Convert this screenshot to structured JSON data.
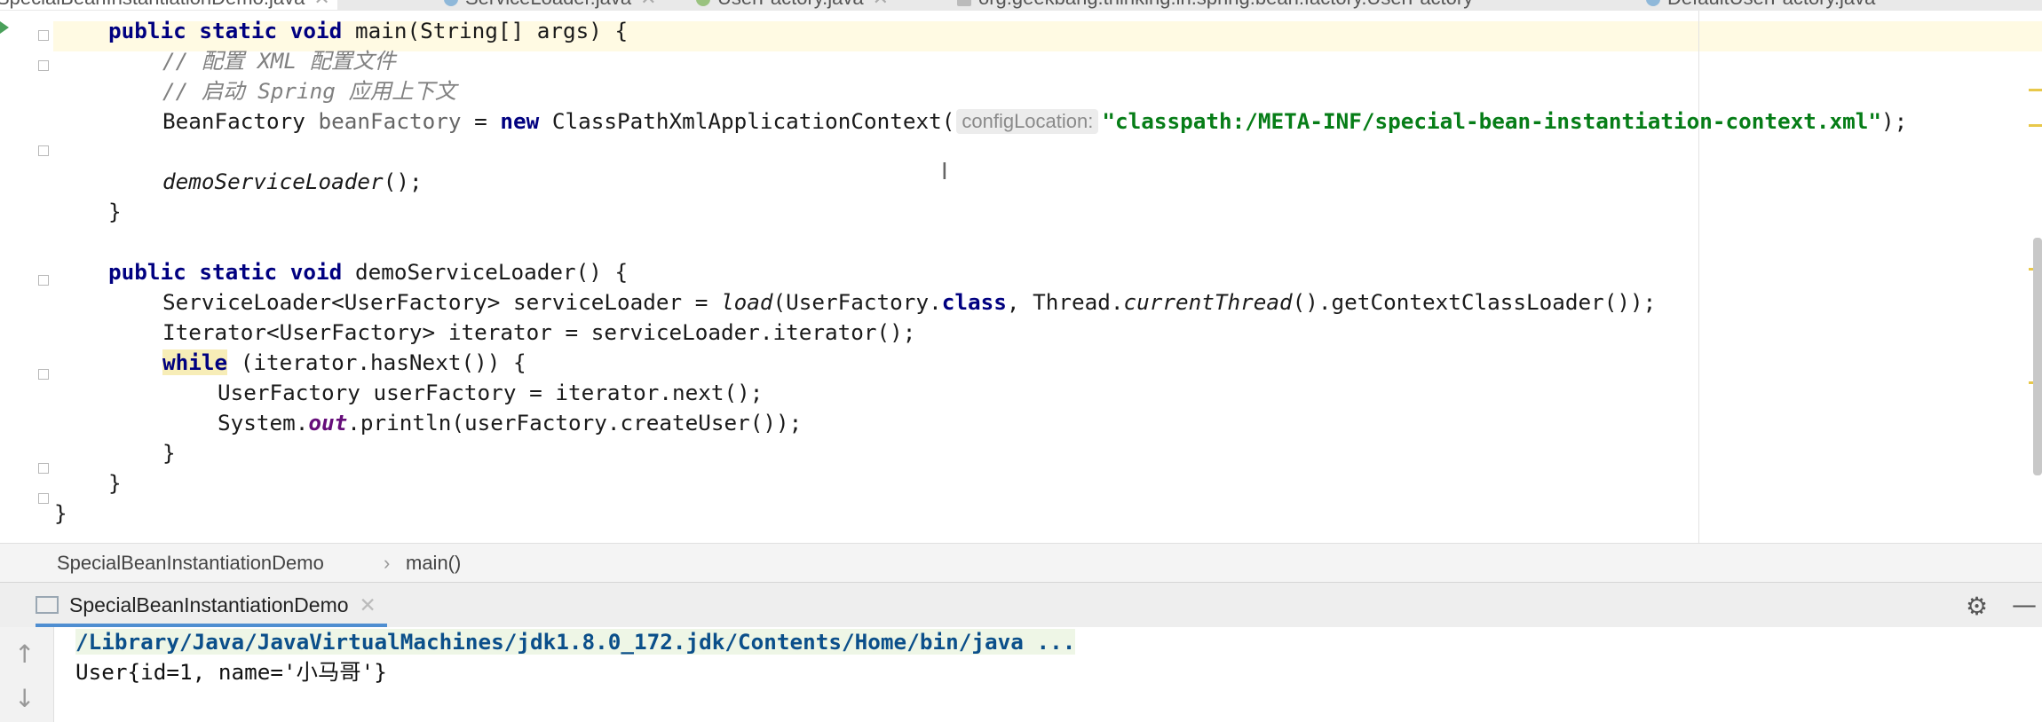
{
  "tabs": [
    {
      "label": "SpecialBeanInstantiationDemo.java",
      "active": true
    },
    {
      "label": "ServiceLoader.java",
      "active": false
    },
    {
      "label": "UserFactory.java",
      "active": false
    },
    {
      "label": "org.geekbang.thinking.in.spring.bean.factory.UserFactory",
      "active": false
    },
    {
      "label": "DefaultUserFactory.java",
      "active": false
    }
  ],
  "code": {
    "l1": {
      "kw": "public static void",
      "rest": " main(String[] args) {"
    },
    "l2": "// 配置 XML 配置文件",
    "l3": "// 启动 Spring 应用上下文",
    "l4": {
      "type": "BeanFactory ",
      "var": "beanFactory",
      "eq": " = ",
      "new": "new",
      "call": " ClassPathXmlApplicationContext(",
      "hint": "configLocation:",
      "str": "\"classpath:/META-INF/special-bean-instantiation-context.xml\"",
      "end": ");"
    },
    "l5": {
      "call": "demoServiceLoader",
      "end": "();"
    },
    "l6": "}",
    "l7": {
      "kw": "public static void",
      "rest": " demoServiceLoader() {"
    },
    "l8": {
      "a": "ServiceLoader<UserFactory> serviceLoader = ",
      "load": "load",
      "b": "(UserFactory.",
      "cls": "class",
      "c": ", Thread.",
      "ct": "currentThread",
      "d": "().getContextClassLoader());"
    },
    "l9": "Iterator<UserFactory> iterator = serviceLoader.iterator();",
    "l10": {
      "kw": "while",
      "rest": " (iterator.hasNext()) {"
    },
    "l11": "UserFactory userFactory = iterator.next();",
    "l12": {
      "a": "System.",
      "out": "out",
      "b": ".println(userFactory.createUser());"
    },
    "l13": "}",
    "l14": "}",
    "l15": "}"
  },
  "breadcrumb": {
    "class_name": "SpecialBeanInstantiationDemo",
    "method": "main()"
  },
  "run_panel": {
    "tab_label": "SpecialBeanInstantiationDemo",
    "command": "/Library/Java/JavaVirtualMachines/jdk1.8.0_172.jdk/Contents/Home/bin/java ...",
    "output": "User{id=1, name='小马哥'}"
  },
  "icons": [
    "run-arrow-icon",
    "fold-icon",
    "close-icon",
    "gear-icon",
    "minimize-icon",
    "up-arrow-icon",
    "down-arrow-icon"
  ],
  "colors": {
    "keyword": "#000080",
    "string": "#067d17",
    "comment": "#808080",
    "active_tab_underline": "#4f8ed1",
    "current_line": "#fffae3"
  }
}
